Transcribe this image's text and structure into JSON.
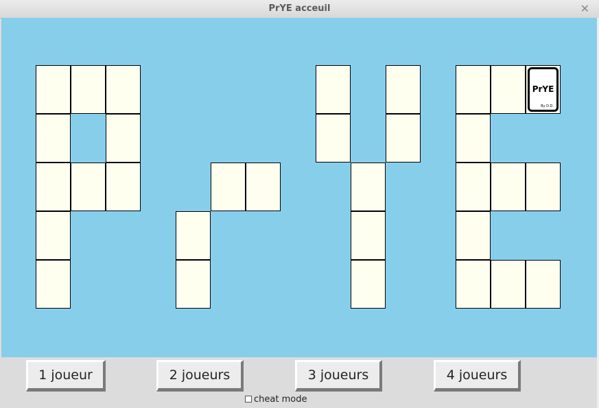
{
  "window": {
    "title": "PrYE acceuil"
  },
  "board": {
    "card_label": "PrYE",
    "card_author": "By D.D."
  },
  "buttons": {
    "one_player": "1 joueur",
    "two_players": "2 joueurs",
    "three_players": "3 joueurs",
    "four_players": "4 joueurs"
  },
  "cheat_mode": {
    "label": "cheat mode",
    "checked": false
  },
  "colors": {
    "background": "#87ceeb",
    "cell": "#fffff0"
  }
}
